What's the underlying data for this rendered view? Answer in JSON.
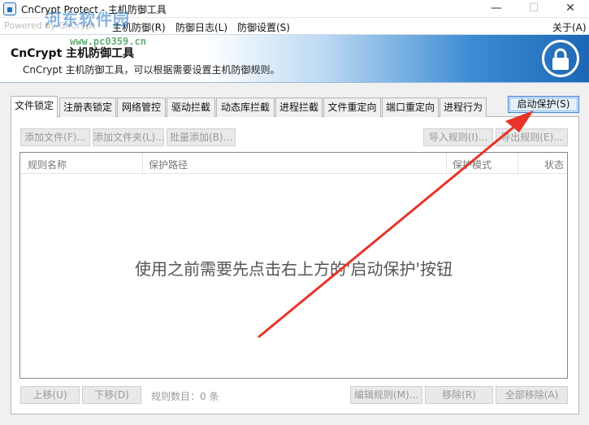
{
  "window": {
    "title": "CnCrypt Protect - 主机防御工具",
    "minimize_label": "—",
    "maximize_label": "☐",
    "close_label": "✕"
  },
  "watermark": {
    "site": "河东软件园",
    "url": "www.pc0359.cn",
    "powered": "Powered by CnCrypt"
  },
  "menu": {
    "items": [
      "主机防御(R)",
      "防御日志(L)",
      "防御设置(S)"
    ],
    "about": "关于(A)"
  },
  "banner": {
    "title": "CnCrypt 主机防御工具",
    "description": "CnCrypt 主机防御工具，可以根据需要设置主机防御规则。",
    "icon": "lock-icon"
  },
  "tabs": [
    "文件锁定",
    "注册表锁定",
    "网络管控",
    "驱动拦截",
    "动态库拦截",
    "进程拦截",
    "文件重定向",
    "端口重定向",
    "进程行为"
  ],
  "start_button": "启动保护(S)",
  "toolbar": {
    "add_file": "添加文件(F)...",
    "add_folder": "添加文件夹(L)...",
    "batch_add": "批量添加(B)...",
    "import_rules": "导入规则(I)...",
    "export_rules": "导出规则(E)..."
  },
  "table": {
    "columns": [
      "规则名称",
      "保护路径",
      "保护模式",
      "状态"
    ],
    "empty_message": "使用之前需要先点击右上方的'启动保护'按钮",
    "rows": []
  },
  "bottom": {
    "move_up": "上移(U)",
    "move_down": "下移(D)",
    "rule_count": "规则数目：0 条",
    "edit_rule": "编辑规则(M)...",
    "remove": "移除(R)",
    "remove_all": "全部移除(A)"
  },
  "colors": {
    "accent": "#1c67b5",
    "arrow": "#e8342a",
    "active_button_border": "#3c7fd6"
  }
}
